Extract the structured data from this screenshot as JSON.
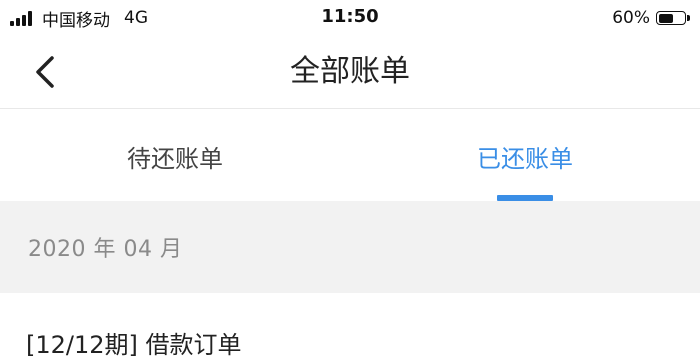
{
  "status_bar": {
    "carrier": "中国移动",
    "network": "4G",
    "time": "11:50",
    "battery_percent": "60%",
    "battery_level": 0.6
  },
  "nav": {
    "title": "全部账单",
    "back_icon": "chevron-left-icon"
  },
  "tabs": [
    {
      "label": "待还账单",
      "active": false
    },
    {
      "label": "已还账单",
      "active": true
    }
  ],
  "colors": {
    "accent": "#3a8ee6",
    "section_bg": "#f2f2f2",
    "muted_text": "#8a8a8a"
  },
  "bills": {
    "month": "2020 年 04 月",
    "items": [
      {
        "title": "[12/12期] 借款订单"
      }
    ]
  }
}
